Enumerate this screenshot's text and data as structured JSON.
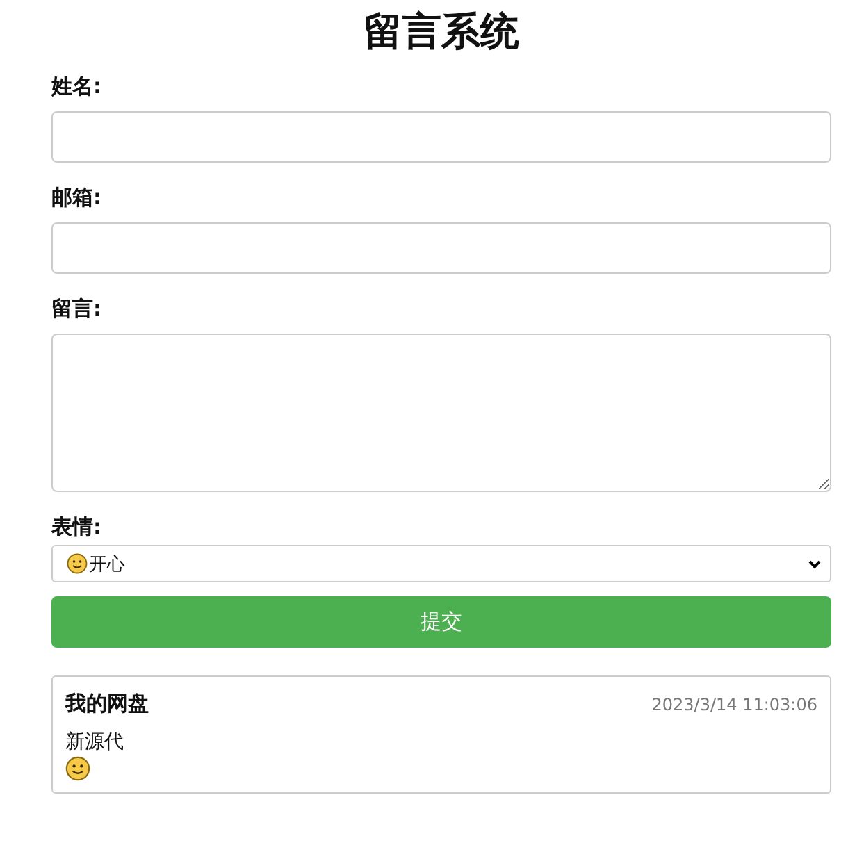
{
  "title": "留言系统",
  "form": {
    "fields": [
      {
        "label": "姓名:",
        "kind": "input"
      },
      {
        "label": "邮箱:",
        "kind": "input"
      },
      {
        "label": "留言:",
        "kind": "textarea"
      }
    ],
    "mood": {
      "label": "表情:",
      "value": "开心"
    },
    "submit": "提交"
  },
  "messages": [
    {
      "name": "我的网盘",
      "time": "2023/3/14 11:03:06",
      "text": "新源代"
    }
  ]
}
